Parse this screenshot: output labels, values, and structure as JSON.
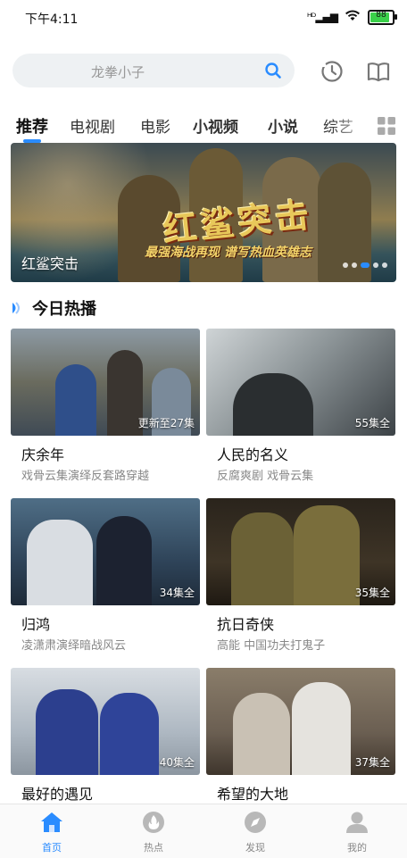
{
  "status_bar": {
    "time": "下午4:11",
    "signal": "ᴴᴰ▂▄▆",
    "battery": "88",
    "battery_level": 0.88
  },
  "search": {
    "placeholder": "龙拳小子"
  },
  "tabs": [
    {
      "label": "推荐"
    },
    {
      "label": "电视剧"
    },
    {
      "label": "电影"
    },
    {
      "label": "小视频"
    },
    {
      "label": "小说"
    },
    {
      "label": "综艺"
    }
  ],
  "banner": {
    "caption": "红鲨突击",
    "art_title": "红鲨突击",
    "tagline": "最强海战再现 谱写热血英雄志"
  },
  "section": {
    "title": "今日热播"
  },
  "cards": [
    {
      "title": "庆余年",
      "subtitle": "戏骨云集演绎反套路穿越",
      "badge": "更新至27集"
    },
    {
      "title": "人民的名义",
      "subtitle": "反腐爽剧 戏骨云集",
      "badge": "55集全"
    },
    {
      "title": "归鸿",
      "subtitle": "凌潇肃演绎暗战风云",
      "badge": "34集全"
    },
    {
      "title": "抗日奇侠",
      "subtitle": "高能 中国功夫打鬼子",
      "badge": "35集全"
    },
    {
      "title": "最好的遇见",
      "subtitle": "",
      "badge": "40集全"
    },
    {
      "title": "希望的大地",
      "subtitle": "",
      "badge": "37集全"
    }
  ],
  "bottom_nav": [
    {
      "label": "首页",
      "icon": "home-icon"
    },
    {
      "label": "热点",
      "icon": "flame-icon"
    },
    {
      "label": "发现",
      "icon": "compass-icon"
    },
    {
      "label": "我的",
      "icon": "user-icon"
    }
  ],
  "colors": {
    "accent": "#2a8cff"
  }
}
